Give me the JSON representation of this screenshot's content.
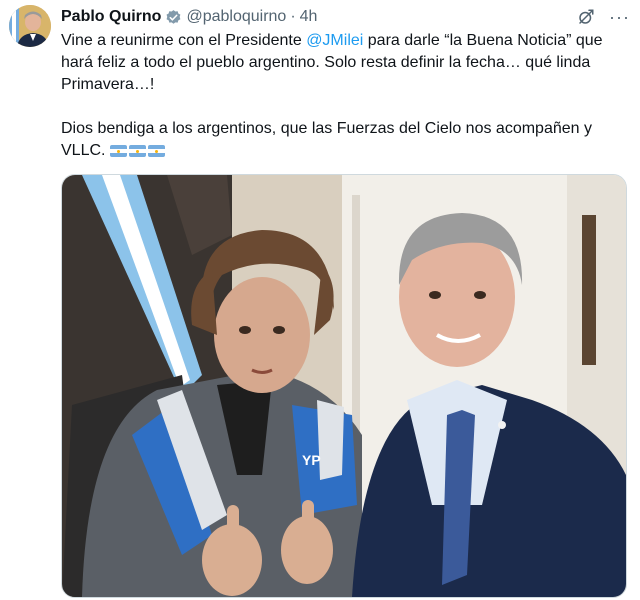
{
  "tweet": {
    "author_name": "Pablo Quirno",
    "handle": "@pabloquirno",
    "separator": "·",
    "time": "4h",
    "text_p1_before": "Vine a reunirme con el Presidente ",
    "mention": "@JMilei",
    "text_p1_after": " para darle “la Buena Noticia” que hará feliz a todo el pueblo argentino. Solo resta definir la fecha… qué linda Primavera…!",
    "text_p2": "Dios bendiga a los argentinos, que las Fuerzas del  Cielo nos acompañen y VLLC. ",
    "flags": [
      "argentina-flag",
      "argentina-flag",
      "argentina-flag"
    ],
    "more_label": "···",
    "photo_jacket_text": "YP"
  },
  "icons": {
    "verified": "verified-badge-icon",
    "grok": "grok-icon",
    "more": "more-options-icon"
  },
  "colors": {
    "link": "#1d9bf0",
    "text": "#0f1419",
    "muted": "#536471",
    "verified": "#829aab"
  }
}
